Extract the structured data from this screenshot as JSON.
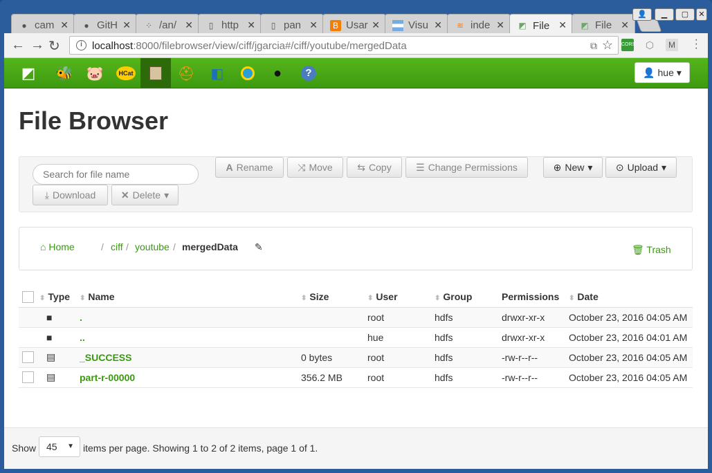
{
  "tabs": [
    {
      "title": "cam",
      "icon": "github-icon"
    },
    {
      "title": "GitH",
      "icon": "github-icon"
    },
    {
      "title": "/an/",
      "icon": "grid-icon"
    },
    {
      "title": "http",
      "icon": "page-icon"
    },
    {
      "title": "pan",
      "icon": "page-icon"
    },
    {
      "title": "Usar",
      "icon": "blogger-icon"
    },
    {
      "title": "Visu",
      "icon": "flag-icon"
    },
    {
      "title": "inde",
      "icon": "stackoverflow-icon"
    },
    {
      "title": "File",
      "icon": "hue-icon"
    },
    {
      "title": "File",
      "icon": "hue-icon"
    }
  ],
  "address": {
    "host": "localhost",
    "rest": ":8000/filebrowser/view/ciff/jgarcia#/ciff/youtube/mergedData"
  },
  "huebar": {
    "user_label": "hue"
  },
  "page": {
    "title": "File Browser"
  },
  "actions": {
    "search_placeholder": "Search for file name",
    "rename": "Rename",
    "move": "Move",
    "copy": "Copy",
    "change_permissions": "Change Permissions",
    "new": "New",
    "upload": "Upload",
    "download": "Download",
    "delete": "Delete"
  },
  "breadcrumb": {
    "home": "Home",
    "parts": [
      "ciff",
      "youtube",
      "mergedData"
    ],
    "trash": "Trash"
  },
  "table": {
    "headers": [
      "Type",
      "Name",
      "Size",
      "User",
      "Group",
      "Permissions",
      "Date"
    ],
    "rows": [
      {
        "type": "folder",
        "name": ".",
        "size": "",
        "user": "root",
        "group": "hdfs",
        "perms": "drwxr-xr-x",
        "date": "October 23, 2016 04:05 AM"
      },
      {
        "type": "folder",
        "name": "..",
        "size": "",
        "user": "hue",
        "group": "hdfs",
        "perms": "drwxr-xr-x",
        "date": "October 23, 2016 04:01 AM"
      },
      {
        "type": "file",
        "name": "_SUCCESS",
        "size": "0 bytes",
        "user": "root",
        "group": "hdfs",
        "perms": "-rw-r--r--",
        "date": "October 23, 2016 04:05 AM"
      },
      {
        "type": "file",
        "name": "part-r-00000",
        "size": "356.2 MB",
        "user": "root",
        "group": "hdfs",
        "perms": "-rw-r--r--",
        "date": "October 23, 2016 04:05 AM"
      }
    ]
  },
  "footer": {
    "show": "Show",
    "page_size": "45",
    "summary": "items per page. Showing 1 to 2 of 2 items, page 1 of 1."
  }
}
